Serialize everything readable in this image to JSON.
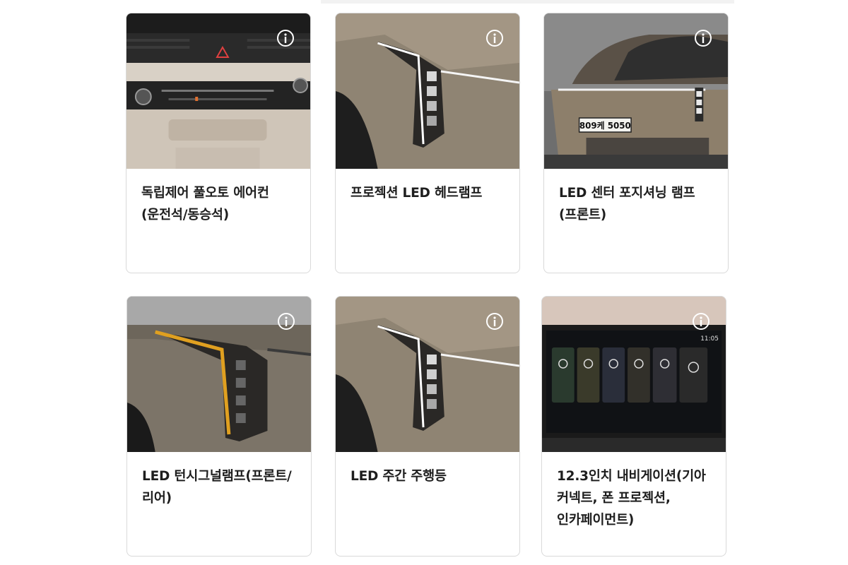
{
  "cards": [
    {
      "caption": "독립제어 풀오토 에어컨(운전석/동승석)",
      "image": "climate-control-panel",
      "info_icon": "info-icon"
    },
    {
      "caption": "프로젝션 LED 헤드램프",
      "image": "projection-led-headlamp",
      "info_icon": "info-icon"
    },
    {
      "caption": "LED 센터 포지셔닝 램프(프론트)",
      "image": "car-front-view",
      "info_icon": "info-icon",
      "plate_text": "809케 5050"
    },
    {
      "caption": "LED 턴시그널램프(프론트/리어)",
      "image": "turn-signal-lamp",
      "info_icon": "info-icon"
    },
    {
      "caption": "LED 주간 주행등",
      "image": "daytime-running-light",
      "info_icon": "info-icon"
    },
    {
      "caption": "12.3인치 내비게이션(기아 커넥트, 폰 프로젝션, 인카페이먼트)",
      "image": "navigation-screen",
      "info_icon": "info-icon",
      "screen_time": "11:05"
    }
  ],
  "colors": {
    "card_border": "#d9d9d9",
    "caption_text": "#1e1e1e",
    "car_body": "#8a7d6a",
    "turn_signal": "#e0a020"
  }
}
